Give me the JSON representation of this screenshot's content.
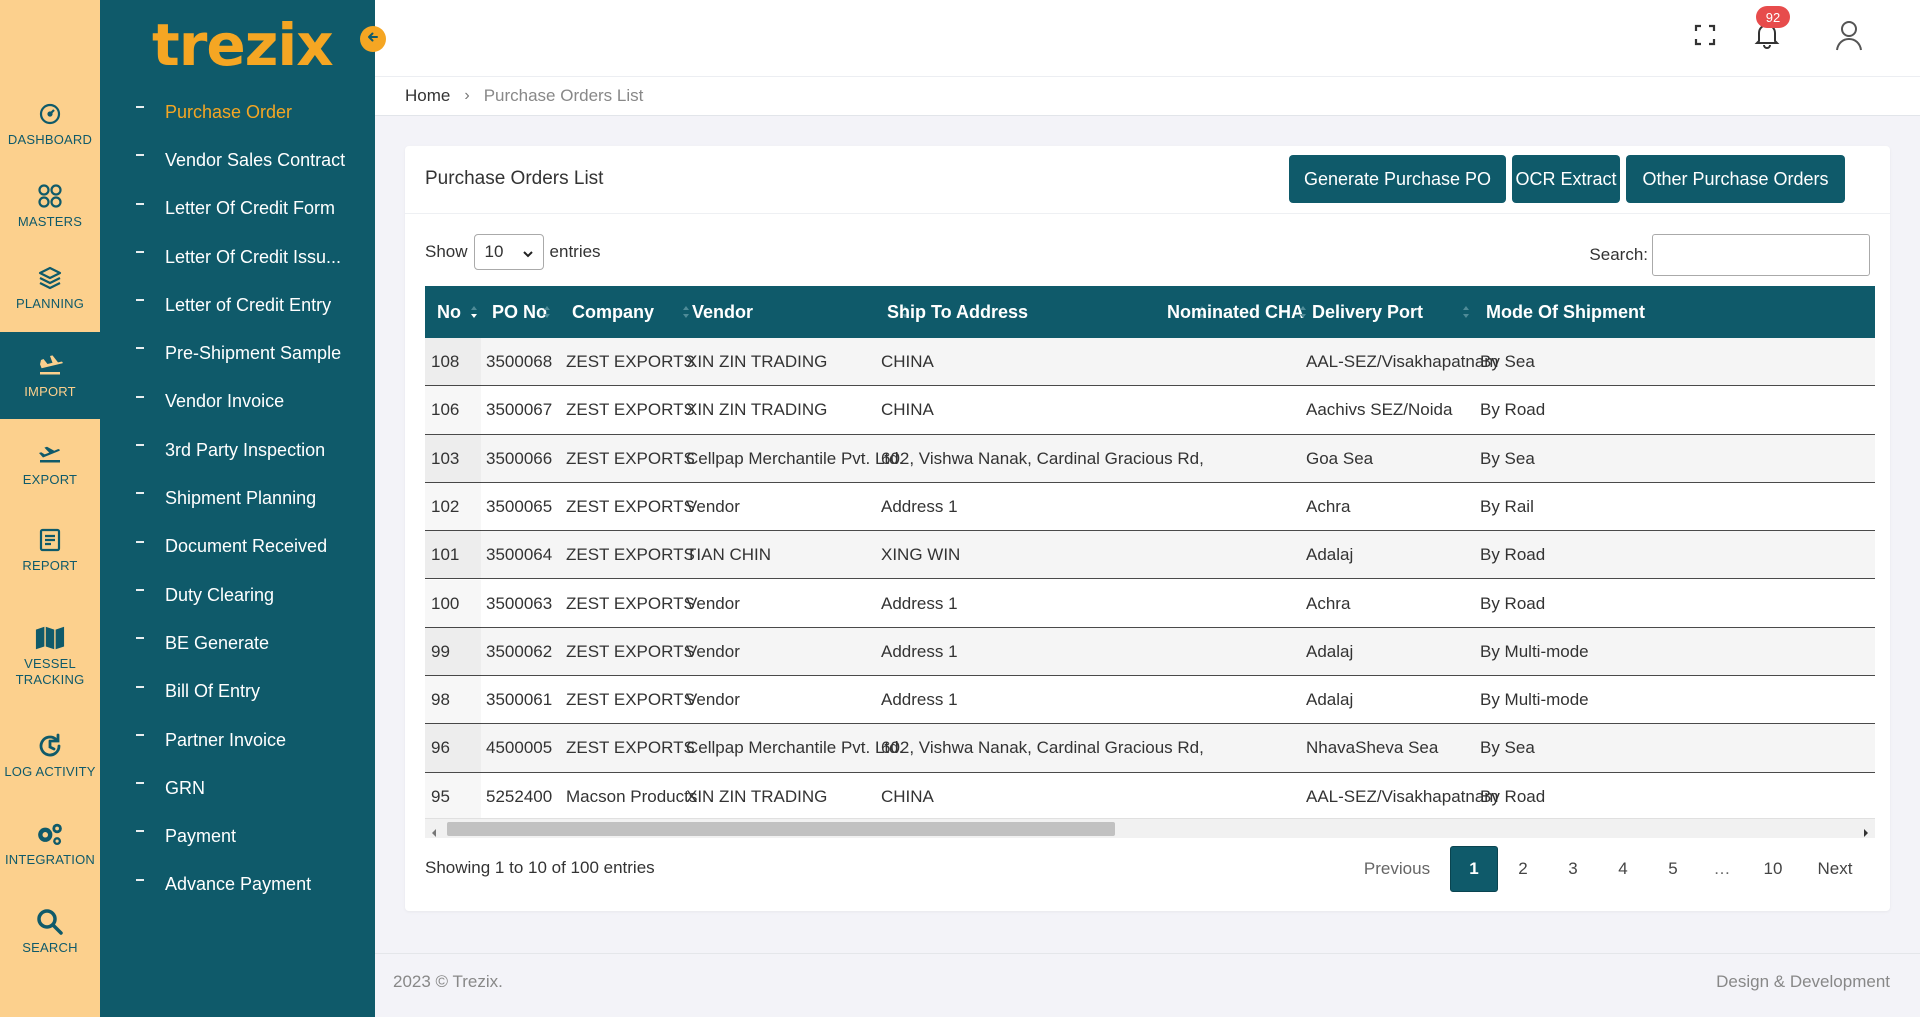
{
  "brand": {
    "logo": "trezix",
    "accent": "#f5a623",
    "primary": "#0f5a6a",
    "rail_bg": "#fcd08d"
  },
  "rail": [
    {
      "label": "DASHBOARD",
      "icon": "dashboard-gauge-icon"
    },
    {
      "label": "MASTERS",
      "icon": "masters-grid-icon"
    },
    {
      "label": "PLANNING",
      "icon": "planning-layers-icon"
    },
    {
      "label": "IMPORT",
      "icon": "import-plane-icon",
      "active": true
    },
    {
      "label": "EXPORT",
      "icon": "export-plane-icon"
    },
    {
      "label": "REPORT",
      "icon": "report-icon"
    },
    {
      "label": "VESSEL TRACKING",
      "icon": "map-icon"
    },
    {
      "label": "LOG ACTIVITY",
      "icon": "history-icon"
    },
    {
      "label": "INTEGRATION",
      "icon": "gears-icon"
    },
    {
      "label": "SEARCH",
      "icon": "search-icon"
    }
  ],
  "sidebar": {
    "items": [
      {
        "label": "Purchase Order",
        "active": true
      },
      {
        "label": "Vendor Sales Contract"
      },
      {
        "label": "Letter Of Credit Form"
      },
      {
        "label": "Letter Of Credit Issu..."
      },
      {
        "label": "Letter of Credit Entry"
      },
      {
        "label": "Pre-Shipment Sample"
      },
      {
        "label": "Vendor Invoice"
      },
      {
        "label": "3rd Party Inspection"
      },
      {
        "label": "Shipment Planning"
      },
      {
        "label": "Document Received"
      },
      {
        "label": "Duty Clearing"
      },
      {
        "label": "BE Generate"
      },
      {
        "label": "Bill Of Entry"
      },
      {
        "label": "Partner Invoice"
      },
      {
        "label": "GRN"
      },
      {
        "label": "Payment"
      },
      {
        "label": "Advance Payment"
      }
    ]
  },
  "topbar": {
    "notification_count": "92"
  },
  "breadcrumb": {
    "home": "Home",
    "separator": "›",
    "current": "Purchase Orders List"
  },
  "card": {
    "title": "Purchase Orders List",
    "buttons": {
      "generate": "Generate Purchase PO",
      "ocr": "OCR Extract",
      "other": "Other Purchase Orders"
    }
  },
  "controls": {
    "show_label": "Show",
    "page_size": "10",
    "entries_label": "entries",
    "search_label": "Search:"
  },
  "table": {
    "columns": [
      "No",
      "PO No",
      "Company",
      "Vendor",
      "Ship To Address",
      "Nominated CHA",
      "Delivery Port",
      "Mode Of Shipment"
    ],
    "rows": [
      [
        "108",
        "3500068",
        "ZEST EXPORTS",
        "XIN ZIN TRADING",
        "CHINA",
        "",
        "AAL-SEZ/Visakhapatnam",
        "By Sea"
      ],
      [
        "106",
        "3500067",
        "ZEST EXPORTS",
        "XIN ZIN TRADING",
        "CHINA",
        "",
        "Aachivs SEZ/Noida",
        "By Road"
      ],
      [
        "103",
        "3500066",
        "ZEST EXPORTS",
        "Cellpap Merchantile Pvt. Ltd.",
        "602, Vishwa Nanak, Cardinal Gracious Rd,",
        "",
        "Goa Sea",
        "By Sea"
      ],
      [
        "102",
        "3500065",
        "ZEST EXPORTS",
        "Vendor",
        "Address 1",
        "",
        "Achra",
        "By Rail"
      ],
      [
        "101",
        "3500064",
        "ZEST EXPORTS",
        "TIAN CHIN",
        "XING WIN",
        "",
        "Adalaj",
        "By Road"
      ],
      [
        "100",
        "3500063",
        "ZEST EXPORTS",
        "Vendor",
        "Address 1",
        "",
        "Achra",
        "By Road"
      ],
      [
        "99",
        "3500062",
        "ZEST EXPORTS",
        "Vendor",
        "Address 1",
        "",
        "Adalaj",
        "By Multi-mode"
      ],
      [
        "98",
        "3500061",
        "ZEST EXPORTS",
        "Vendor",
        "Address 1",
        "",
        "Adalaj",
        "By Multi-mode"
      ],
      [
        "96",
        "4500005",
        "ZEST EXPORTS",
        "Cellpap Merchantile Pvt. Ltd.",
        "602, Vishwa Nanak, Cardinal Gracious Rd,",
        "",
        "NhavaSheva Sea",
        "By Sea"
      ],
      [
        "95",
        "5252400",
        "Macson Products",
        "XIN ZIN TRADING",
        "CHINA",
        "",
        "AAL-SEZ/Visakhapatnam",
        "By Road"
      ]
    ]
  },
  "pagination": {
    "info": "Showing 1 to 10 of 100 entries",
    "previous": "Previous",
    "pages": [
      "1",
      "2",
      "3",
      "4",
      "5",
      "…",
      "10"
    ],
    "current": "1",
    "next": "Next"
  },
  "footer": {
    "copyright": "2023 © Trezix.",
    "credit": "Design & Development"
  }
}
